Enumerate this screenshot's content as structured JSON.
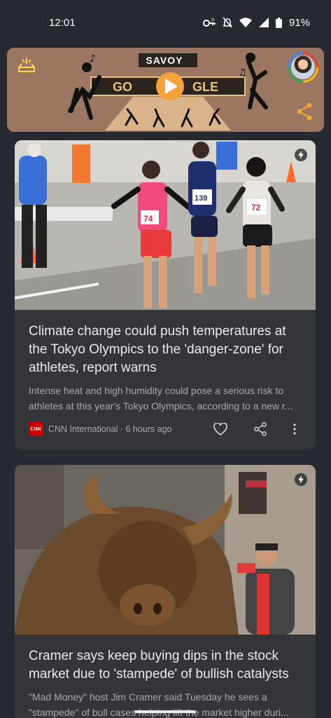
{
  "status_bar": {
    "time": "12:01",
    "battery": "91%",
    "icons": [
      "key-icon",
      "bell-off-icon",
      "wifi-icon",
      "signal-icon",
      "battery-icon"
    ]
  },
  "doodle": {
    "title": "SAVOY",
    "logo_letters": "GOOGLE",
    "background_color": "#9b7660"
  },
  "articles": [
    {
      "headline": "Climate change could push temperatures at the Tokyo Olympics to the 'danger-zone' for athletes, report warns",
      "snippet": "Intense heat and high humidity could pose a serious risk to athletes at this year's Tokyo Olympics, according to a new r...",
      "source": "CNN International",
      "time": "6 hours ago",
      "logo_text": "CNN",
      "runner_bibs": [
        "74",
        "139",
        "72"
      ]
    },
    {
      "headline": "Cramer says keep buying dips in the stock market due to 'stampede' of bullish catalysts",
      "snippet": "\"Mad Money\" host Jim Cramer said Tuesday he sees a \"stampede\" of bull cases helping lift the market higher duri..."
    }
  ],
  "colors": {
    "background": "#26292f",
    "card": "#333538",
    "text_primary": "#e8eaed",
    "text_secondary": "#a8abaf",
    "cnn_red": "#cc0000"
  }
}
